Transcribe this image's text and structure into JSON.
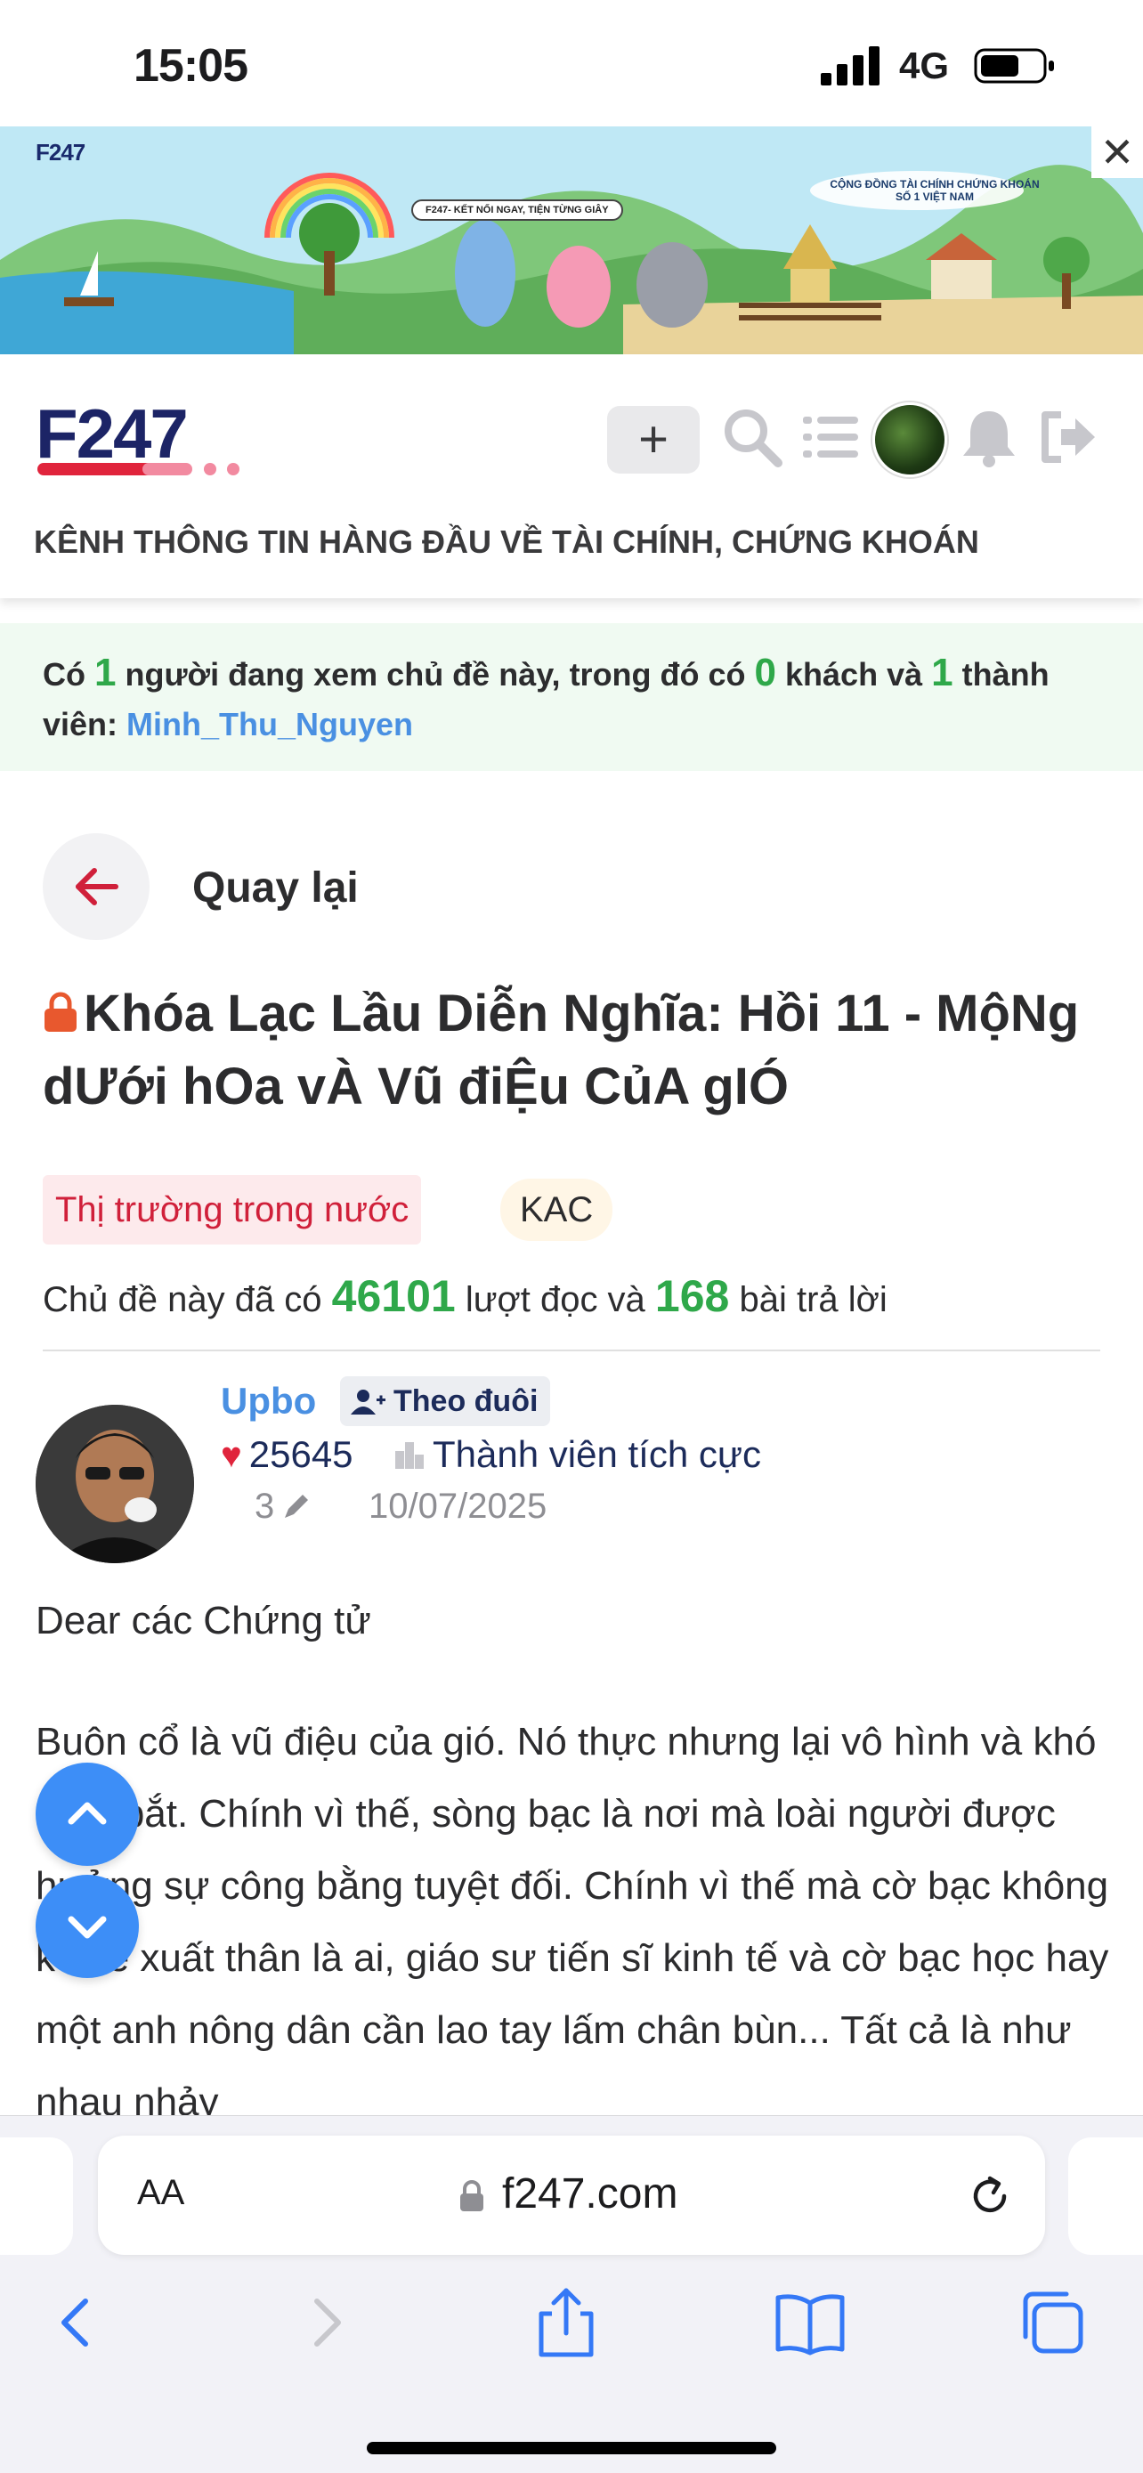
{
  "status_bar": {
    "time": "15:05",
    "network": "4G"
  },
  "ad_banner": {
    "brand": "F247",
    "bubble_text": "F247- KẾT NỐI NGAY, TIỆN TỪNG GIÂY",
    "tagline": "CỘNG ĐỒNG TÀI CHÍNH CHỨNG KHOÁN SỐ 1 VIỆT NAM",
    "close_glyph": "✕"
  },
  "header": {
    "logo_text": "F247",
    "plus_label": "+",
    "slogan": "KÊNH THÔNG TIN HÀNG ĐẦU VỀ TÀI CHÍNH, CHỨNG KHOÁN"
  },
  "viewers": {
    "prefix": "Có ",
    "total": "1",
    "mid1": " người đang xem chủ đề này, trong đó có ",
    "guests": "0",
    "mid2": " khách và ",
    "members": "1",
    "suffix": " thành viên: ",
    "user": "Minh_Thu_Nguyen"
  },
  "back": {
    "label": "Quay lại"
  },
  "topic": {
    "title": "Khóa Lạc Lầu Diễn Nghĩa: Hồi 11 - MộNg dƯới hOa vÀ Vũ điỆu CủA gIÓ",
    "category": "Thị trường trong nước",
    "ticker": "KAC",
    "stats_prefix": "Chủ đề này đã có ",
    "reads": "46101",
    "stats_mid": " lượt đọc và ",
    "replies": "168",
    "stats_suffix": " bài trả lời"
  },
  "author": {
    "name": "Upbo",
    "follow_label": "Theo đuôi",
    "likes": "25645",
    "rank": "Thành viên tích cực",
    "edit_count": "3",
    "date": "10/07/2025"
  },
  "post": {
    "greeting": "Dear các Chứng tử",
    "body": "Buôn cổ là vũ điệu của gió. Nó thực nhưng lại vô hình và khó nắm bắt. Chính vì thế, sòng bạc là nơi mà loài người được hưởng sự công bằng tuyệt đối. Chính vì thế mà cờ bạc không kể kẻ xuất thân là ai, giáo sư tiến sĩ kinh tế và cờ bạc học hay một anh nông dân cần lao tay lấm chân bùn... Tất cả là như nhau nhảy"
  },
  "browser": {
    "aa_label": "AA",
    "url": "f247.com"
  },
  "colors": {
    "accent_green": "#2fa84a",
    "link_blue": "#4a90e2",
    "brand_red": "#e0243c",
    "fab_blue": "#3d8ef7"
  },
  "icons": [
    "signal-icon",
    "battery-icon",
    "close-icon",
    "search-icon",
    "menu-icon",
    "bell-icon",
    "logout-icon",
    "back-arrow-icon",
    "lock-icon",
    "follow-user-icon",
    "heart-icon",
    "rank-icon",
    "pencil-icon",
    "chevron-up-icon",
    "chevron-down-icon",
    "reload-icon",
    "nav-back-icon",
    "nav-forward-icon",
    "share-icon",
    "bookmarks-icon",
    "tabs-icon"
  ]
}
